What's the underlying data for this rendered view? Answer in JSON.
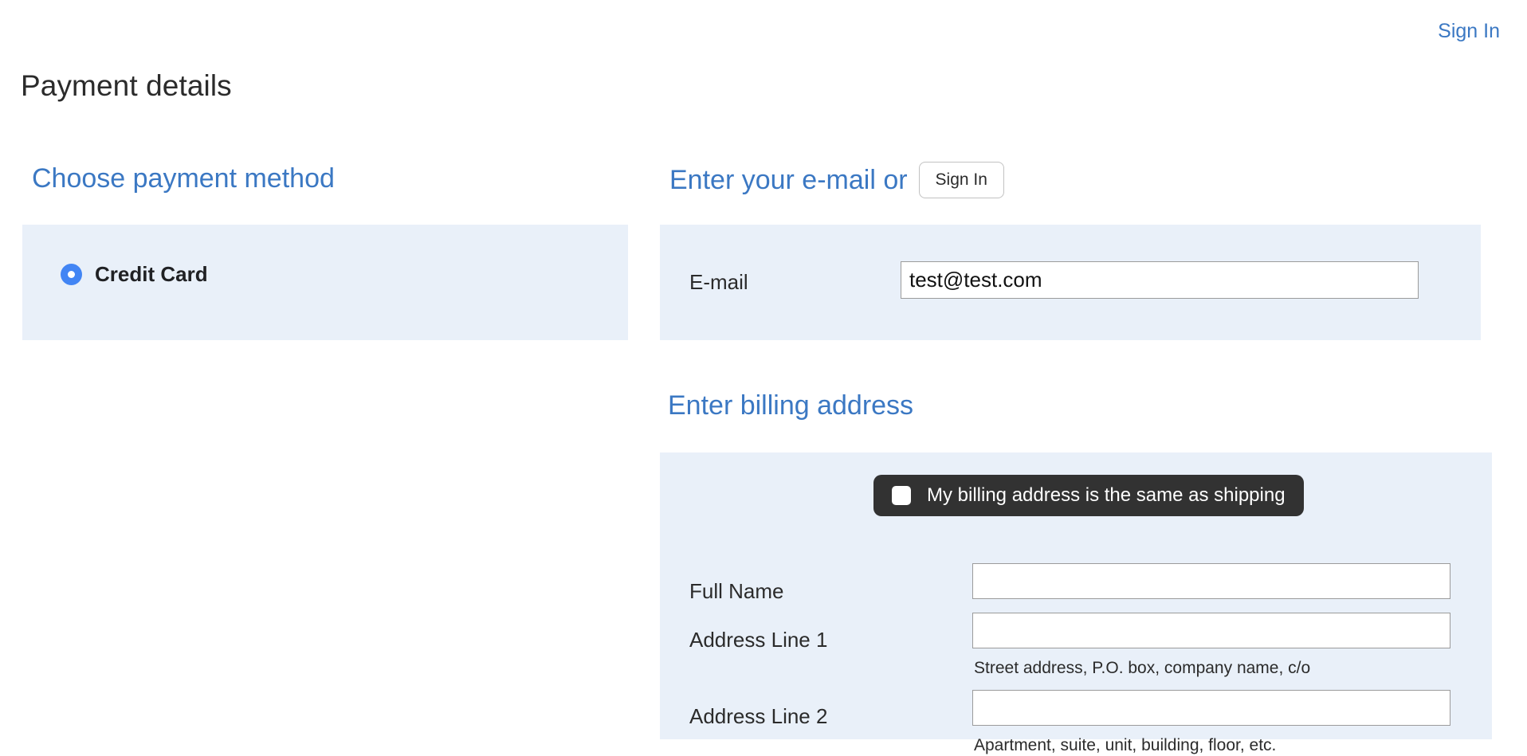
{
  "topbar": {
    "signin_link": "Sign In"
  },
  "page": {
    "title": "Payment details"
  },
  "payment_method": {
    "heading": "Choose payment method",
    "options": [
      {
        "label": "Credit Card",
        "selected": true
      }
    ]
  },
  "email_section": {
    "heading": "Enter your e-mail or",
    "signin_button": "Sign In",
    "email_label": "E-mail",
    "email_value": "test@test.com",
    "email_placeholder": ""
  },
  "billing_section": {
    "heading": "Enter billing address",
    "same_as_shipping": {
      "label": "My billing address is the same as shipping",
      "checked": false
    },
    "fields": [
      {
        "label": "Full Name",
        "value": "",
        "placeholder": "",
        "helper": ""
      },
      {
        "label": "Address Line 1",
        "value": "",
        "placeholder": "",
        "helper": "Street address, P.O. box, company name, c/o"
      },
      {
        "label": "Address Line 2",
        "value": "",
        "placeholder": "",
        "helper": "Apartment, suite, unit, building, floor, etc."
      }
    ]
  },
  "colors": {
    "accent_blue": "#3b78c3",
    "panel_bg": "#e9f0f9",
    "radio_blue": "#4285f4",
    "tooltip_bg": "#323232",
    "page_bg": "#ffffff"
  }
}
